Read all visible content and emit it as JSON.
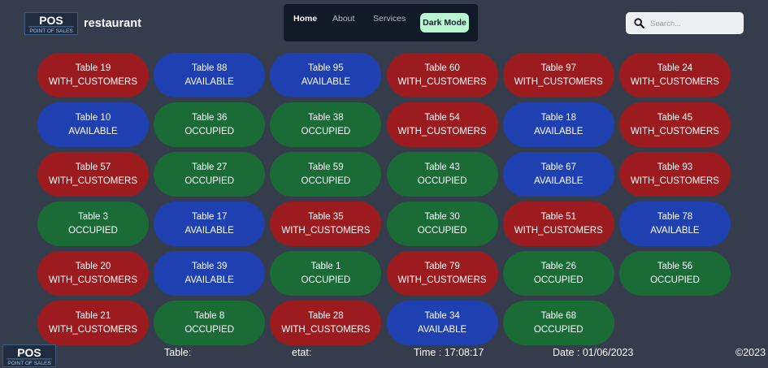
{
  "header": {
    "logo_text": "POS",
    "logo_sub": "POINT OF SALES",
    "brand": "restaurant"
  },
  "nav": {
    "home": "Home",
    "about": "About",
    "services": "Services",
    "dark_mode": "Dark Mode"
  },
  "search": {
    "placeholder": "Search..."
  },
  "colors": {
    "WITH_CUSTOMERS": "#9c1b1f",
    "AVAILABLE": "#1f40b0",
    "OCCUPIED": "#1a6b36",
    "background": "#353d4d",
    "nav_bg": "#111a27",
    "dark_mode_btn": "#b9f5d0"
  },
  "tables": [
    {
      "label": "Table 19",
      "status": "WITH_CUSTOMERS"
    },
    {
      "label": "Table 88",
      "status": "AVAILABLE"
    },
    {
      "label": "Table 95",
      "status": "AVAILABLE"
    },
    {
      "label": "Table 60",
      "status": "WITH_CUSTOMERS"
    },
    {
      "label": "Table 97",
      "status": "WITH_CUSTOMERS"
    },
    {
      "label": "Table 24",
      "status": "WITH_CUSTOMERS"
    },
    {
      "label": "Table 10",
      "status": "AVAILABLE"
    },
    {
      "label": "Table 36",
      "status": "OCCUPIED"
    },
    {
      "label": "Table 38",
      "status": "OCCUPIED"
    },
    {
      "label": "Table 54",
      "status": "WITH_CUSTOMERS"
    },
    {
      "label": "Table 18",
      "status": "AVAILABLE"
    },
    {
      "label": "Table 45",
      "status": "WITH_CUSTOMERS"
    },
    {
      "label": "Table 57",
      "status": "WITH_CUSTOMERS"
    },
    {
      "label": "Table 27",
      "status": "OCCUPIED"
    },
    {
      "label": "Table 59",
      "status": "OCCUPIED"
    },
    {
      "label": "Table 43",
      "status": "OCCUPIED"
    },
    {
      "label": "Table 67",
      "status": "AVAILABLE"
    },
    {
      "label": "Table 93",
      "status": "WITH_CUSTOMERS"
    },
    {
      "label": "Table 3",
      "status": "OCCUPIED"
    },
    {
      "label": "Table 17",
      "status": "AVAILABLE"
    },
    {
      "label": "Table 35",
      "status": "WITH_CUSTOMERS"
    },
    {
      "label": "Table 30",
      "status": "OCCUPIED"
    },
    {
      "label": "Table 51",
      "status": "WITH_CUSTOMERS"
    },
    {
      "label": "Table 78",
      "status": "AVAILABLE"
    },
    {
      "label": "Table 20",
      "status": "WITH_CUSTOMERS"
    },
    {
      "label": "Table 39",
      "status": "AVAILABLE"
    },
    {
      "label": "Table 1",
      "status": "OCCUPIED"
    },
    {
      "label": "Table 79",
      "status": "WITH_CUSTOMERS"
    },
    {
      "label": "Table 26",
      "status": "OCCUPIED"
    },
    {
      "label": "Table 56",
      "status": "OCCUPIED"
    },
    {
      "label": "Table 21",
      "status": "WITH_CUSTOMERS"
    },
    {
      "label": "Table 8",
      "status": "OCCUPIED"
    },
    {
      "label": "Table 28",
      "status": "WITH_CUSTOMERS"
    },
    {
      "label": "Table 34",
      "status": "AVAILABLE"
    },
    {
      "label": "Table 68",
      "status": "OCCUPIED"
    }
  ],
  "footer": {
    "table_label": "Table:",
    "etat_label": "etat:",
    "time": "Time : 17:08:17",
    "date": "Date : 01/06/2023",
    "copyright": "©2023"
  }
}
